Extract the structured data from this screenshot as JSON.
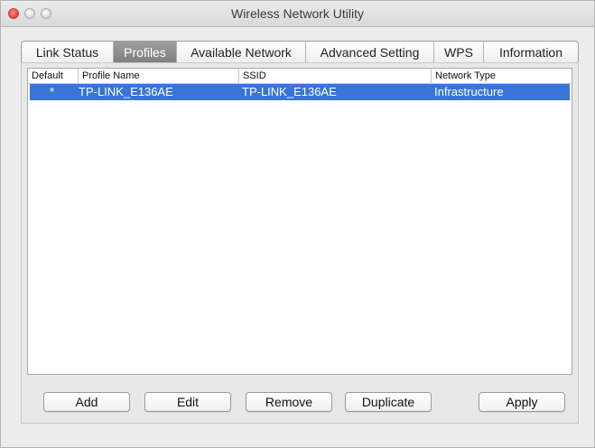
{
  "window": {
    "title": "Wireless Network Utility"
  },
  "tabs": [
    {
      "label": "Link Status",
      "active": false
    },
    {
      "label": "Profiles",
      "active": true
    },
    {
      "label": "Available Network",
      "active": false
    },
    {
      "label": "Advanced Setting",
      "active": false
    },
    {
      "label": "WPS",
      "active": false
    },
    {
      "label": "Information",
      "active": false
    }
  ],
  "profiles_table": {
    "columns": [
      "Default",
      "Profile Name",
      "SSID",
      "Network Type"
    ],
    "rows": [
      {
        "default": "*",
        "profile_name": "TP-LINK_E136AE",
        "ssid": "TP-LINK_E136AE",
        "network_type": "Infrastructure",
        "selected": true
      }
    ]
  },
  "buttons": {
    "add": "Add",
    "edit": "Edit",
    "remove": "Remove",
    "duplicate": "Duplicate",
    "apply": "Apply"
  },
  "colors": {
    "selection": "#3875d7",
    "active_tab": "#8a8a8a",
    "close_button": "#e0443e"
  }
}
